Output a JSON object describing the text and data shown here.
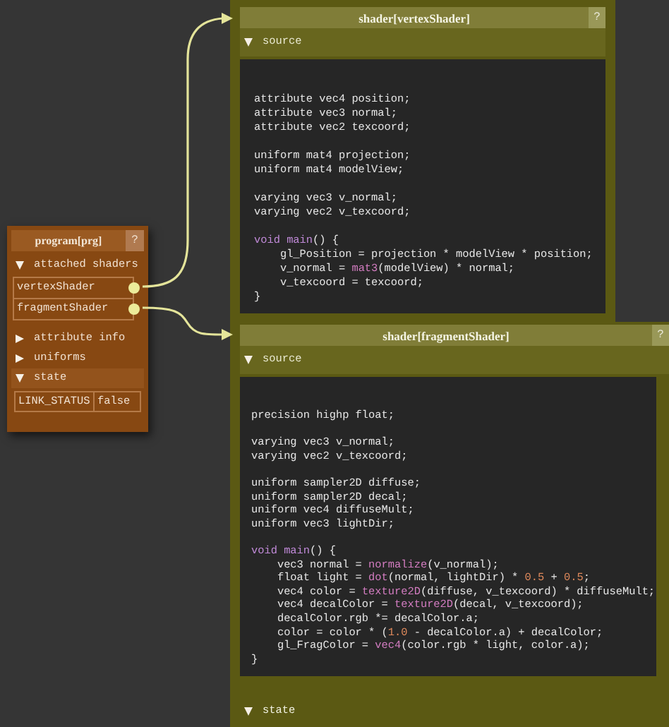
{
  "program_node": {
    "title": "program[prg]",
    "help": "?",
    "sections": [
      {
        "label": "attached shaders",
        "expanded": true,
        "kind": "list",
        "items": [
          {
            "label": "vertexShader"
          },
          {
            "label": "fragmentShader"
          }
        ]
      },
      {
        "label": "attribute info",
        "expanded": false,
        "kind": "list"
      },
      {
        "label": "uniforms",
        "expanded": false,
        "kind": "list"
      },
      {
        "label": "state",
        "expanded": true,
        "kind": "table",
        "rows": [
          {
            "name": "LINK_STATUS",
            "value": "false"
          }
        ]
      }
    ]
  },
  "shader_nodes": [
    {
      "title": "shader[vertexShader]",
      "help": "?",
      "source": {
        "label": "source",
        "expanded": true,
        "code_blocks": [
          [
            [
              {
                "text": "attribute vec4 position;",
                "kind": "plain"
              }
            ],
            [
              {
                "text": "attribute vec3 normal;",
                "kind": "plain"
              }
            ],
            [
              {
                "text": "attribute vec2 texcoord;",
                "kind": "plain"
              }
            ]
          ],
          [
            [
              {
                "text": "uniform mat4 projection;",
                "kind": "plain"
              }
            ],
            [
              {
                "text": "uniform mat4 modelView;",
                "kind": "plain"
              }
            ]
          ],
          [
            [
              {
                "text": "varying vec3 v_normal;",
                "kind": "plain"
              }
            ],
            [
              {
                "text": "varying vec2 v_texcoord;",
                "kind": "plain"
              }
            ]
          ],
          [
            [
              {
                "text": "void main",
                "kind": "keyword"
              },
              {
                "text": "() {",
                "kind": "plain"
              }
            ],
            [
              {
                "text": "    gl_Position = projection * modelView * position;",
                "kind": "plain"
              }
            ],
            [
              {
                "text": "    v_normal = ",
                "kind": "plain"
              },
              {
                "text": "mat3",
                "kind": "builtin"
              },
              {
                "text": "(modelView) * normal;",
                "kind": "plain"
              }
            ],
            [
              {
                "text": "    v_texcoord = texcoord;",
                "kind": "plain"
              }
            ],
            [
              {
                "text": "}",
                "kind": "plain"
              }
            ]
          ]
        ]
      }
    },
    {
      "title": "shader[fragmentShader]",
      "help": "?",
      "source": {
        "label": "source",
        "expanded": true,
        "code_blocks": [
          [
            [
              {
                "text": "precision highp float;",
                "kind": "plain"
              }
            ]
          ],
          [
            [
              {
                "text": "varying vec3 v_normal;",
                "kind": "plain"
              }
            ],
            [
              {
                "text": "varying vec2 v_texcoord;",
                "kind": "plain"
              }
            ]
          ],
          [
            [
              {
                "text": "uniform sampler2D diffuse;",
                "kind": "plain"
              }
            ],
            [
              {
                "text": "uniform sampler2D decal;",
                "kind": "plain"
              }
            ],
            [
              {
                "text": "uniform vec4 diffuseMult;",
                "kind": "plain"
              }
            ],
            [
              {
                "text": "uniform vec3 lightDir;",
                "kind": "plain"
              }
            ]
          ],
          [
            [
              {
                "text": "void main",
                "kind": "keyword"
              },
              {
                "text": "() {",
                "kind": "plain"
              }
            ],
            [
              {
                "text": "    vec3 normal = ",
                "kind": "plain"
              },
              {
                "text": "normalize",
                "kind": "builtin"
              },
              {
                "text": "(v_normal);",
                "kind": "plain"
              }
            ],
            [
              {
                "text": "    float light = ",
                "kind": "plain"
              },
              {
                "text": "dot",
                "kind": "builtin"
              },
              {
                "text": "(normal, lightDir) * ",
                "kind": "plain"
              },
              {
                "text": "0.5",
                "kind": "number"
              },
              {
                "text": " + ",
                "kind": "plain"
              },
              {
                "text": "0.5",
                "kind": "number"
              },
              {
                "text": ";",
                "kind": "plain"
              }
            ],
            [
              {
                "text": "    vec4 color = ",
                "kind": "plain"
              },
              {
                "text": "texture2D",
                "kind": "builtin"
              },
              {
                "text": "(diffuse, v_texcoord) * diffuseMult;",
                "kind": "plain"
              }
            ],
            [
              {
                "text": "    vec4 decalColor = ",
                "kind": "plain"
              },
              {
                "text": "texture2D",
                "kind": "builtin"
              },
              {
                "text": "(decal, v_texcoord);",
                "kind": "plain"
              }
            ],
            [
              {
                "text": "    decalColor.rgb *= decalColor.a;",
                "kind": "plain"
              }
            ],
            [
              {
                "text": "    color = color * (",
                "kind": "plain"
              },
              {
                "text": "1.0",
                "kind": "number"
              },
              {
                "text": " - decalColor.a) + decalColor;",
                "kind": "plain"
              }
            ],
            [
              {
                "text": "    gl_FragColor = ",
                "kind": "plain"
              },
              {
                "text": "vec4",
                "kind": "builtin"
              },
              {
                "text": "(color.rgb * light, color.a);",
                "kind": "plain"
              }
            ],
            [
              {
                "text": "}",
                "kind": "plain"
              }
            ]
          ]
        ]
      },
      "state": {
        "label": "state",
        "expanded": true
      }
    }
  ]
}
